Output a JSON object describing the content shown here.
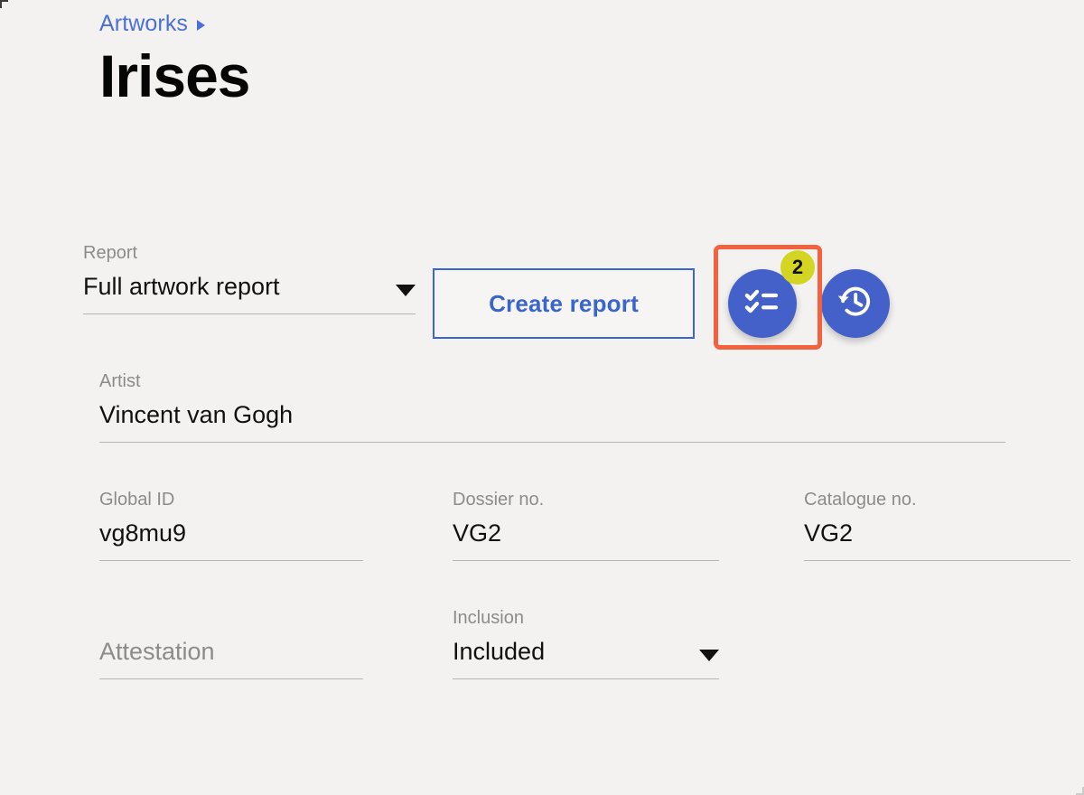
{
  "colors": {
    "background": "#f4f2f1",
    "accent_blue": "#4361c8",
    "link_blue": "#4a6fd6",
    "button_border": "#3a66cc",
    "highlight_orange": "#f4613e",
    "badge_yellow": "#d4d422",
    "label_grey": "#8e8a88",
    "underline_grey": "#b9b5b2"
  },
  "header": {
    "breadcrumb": {
      "label": "Artworks",
      "caret_icon": "chevron-right-icon"
    },
    "title": "Irises"
  },
  "toolbar": {
    "report_field": {
      "label": "Report",
      "value": "Full artwork report",
      "caret_icon": "chevron-down-icon"
    },
    "create_report_label": "Create report",
    "checklist_button": {
      "icon": "checklist-icon",
      "badge_count": "2",
      "highlighted": true
    },
    "history_button": {
      "icon": "history-restore-icon"
    }
  },
  "form": {
    "artist": {
      "label": "Artist",
      "value": "Vincent van Gogh"
    },
    "global_id": {
      "label": "Global ID",
      "value": "vg8mu9"
    },
    "dossier_no": {
      "label": "Dossier no.",
      "value": "VG2"
    },
    "catalogue_no": {
      "label": "Catalogue no.",
      "value": "VG2"
    },
    "attestation": {
      "label": "",
      "placeholder": "Attestation",
      "value": ""
    },
    "inclusion": {
      "label": "Inclusion",
      "value": "Included",
      "caret_icon": "chevron-down-icon"
    }
  }
}
